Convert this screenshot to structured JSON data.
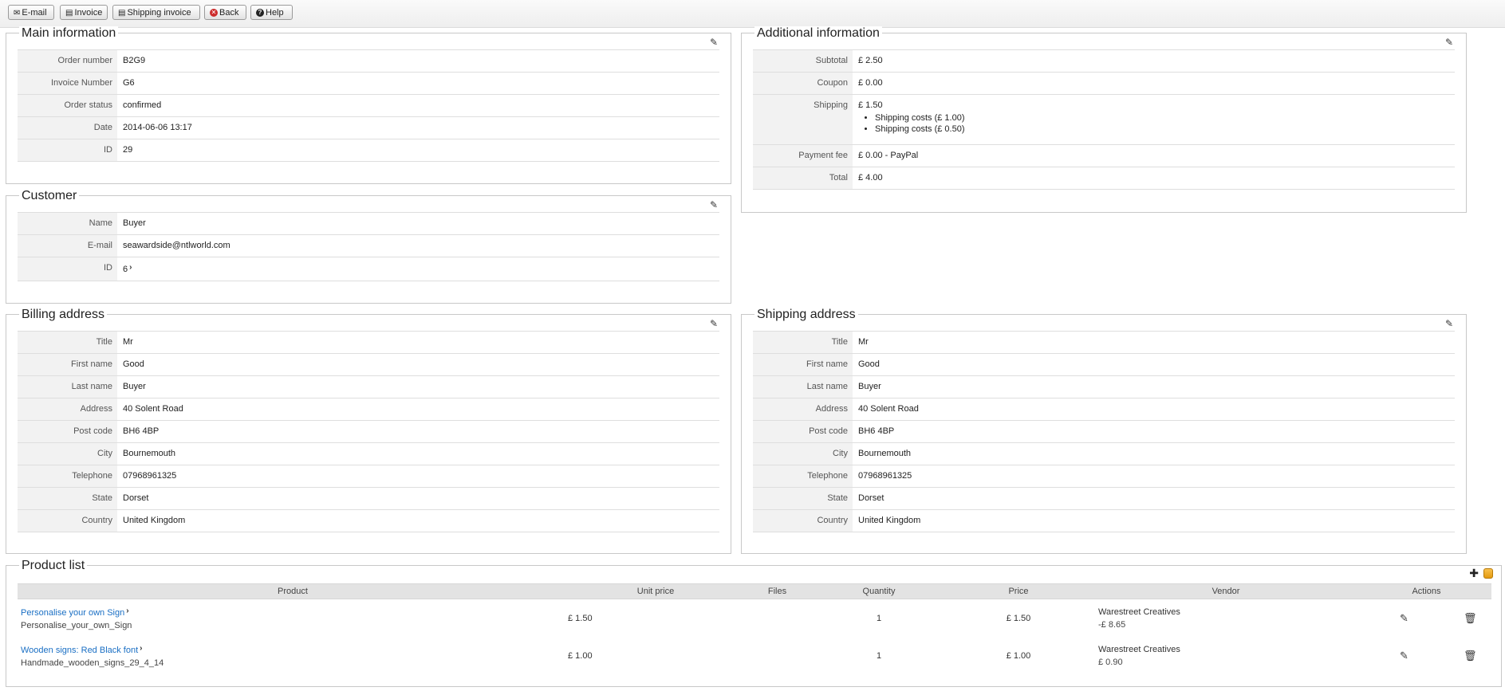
{
  "toolbar": {
    "email": "E-mail",
    "invoice": "Invoice",
    "shipping_invoice": "Shipping invoice",
    "back": "Back",
    "help": "Help"
  },
  "main_info": {
    "title": "Main information",
    "rows": [
      {
        "label": "Order number",
        "value": "B2G9"
      },
      {
        "label": "Invoice Number",
        "value": "G6"
      },
      {
        "label": "Order status",
        "value": "confirmed"
      },
      {
        "label": "Date",
        "value": "2014-06-06 13:17"
      },
      {
        "label": "ID",
        "value": "29"
      }
    ]
  },
  "additional_info": {
    "title": "Additional information",
    "subtotal_label": "Subtotal",
    "subtotal": "£ 2.50",
    "coupon_label": "Coupon",
    "coupon": "£ 0.00",
    "shipping_label": "Shipping",
    "shipping": "£ 1.50",
    "shipping_items": [
      "Shipping costs (£ 1.00)",
      "Shipping costs (£ 0.50)"
    ],
    "payment_fee_label": "Payment fee",
    "payment_fee": "£ 0.00 - PayPal",
    "total_label": "Total",
    "total": "£ 4.00"
  },
  "customer": {
    "title": "Customer",
    "name_label": "Name",
    "name": "Buyer",
    "email_label": "E-mail",
    "email": "seawardside@ntlworld.com",
    "id_label": "ID",
    "id": "6"
  },
  "billing": {
    "title": "Billing address",
    "rows": [
      {
        "label": "Title",
        "value": "Mr"
      },
      {
        "label": "First name",
        "value": "Good"
      },
      {
        "label": "Last name",
        "value": "Buyer"
      },
      {
        "label": "Address",
        "value": "40 Solent Road"
      },
      {
        "label": "Post code",
        "value": "BH6 4BP"
      },
      {
        "label": "City",
        "value": "Bournemouth"
      },
      {
        "label": "Telephone",
        "value": "07968961325"
      },
      {
        "label": "State",
        "value": "Dorset"
      },
      {
        "label": "Country",
        "value": "United Kingdom"
      }
    ]
  },
  "shipping_addr": {
    "title": "Shipping address",
    "rows": [
      {
        "label": "Title",
        "value": "Mr"
      },
      {
        "label": "First name",
        "value": "Good"
      },
      {
        "label": "Last name",
        "value": "Buyer"
      },
      {
        "label": "Address",
        "value": "40 Solent Road"
      },
      {
        "label": "Post code",
        "value": "BH6 4BP"
      },
      {
        "label": "City",
        "value": "Bournemouth"
      },
      {
        "label": "Telephone",
        "value": "07968961325"
      },
      {
        "label": "State",
        "value": "Dorset"
      },
      {
        "label": "Country",
        "value": "United Kingdom"
      }
    ]
  },
  "products": {
    "title": "Product list",
    "headers": {
      "product": "Product",
      "unit_price": "Unit price",
      "files": "Files",
      "quantity": "Quantity",
      "price": "Price",
      "vendor": "Vendor",
      "actions": "Actions"
    },
    "items": [
      {
        "name": "Personalise your own Sign",
        "sku": "Personalise_your_own_Sign",
        "unit_price": "£ 1.50",
        "files": "",
        "quantity": "1",
        "price": "£ 1.50",
        "vendor": "Warestreet Creatives",
        "vendor_amount": "-£ 8.65"
      },
      {
        "name": "Wooden signs: Red Black font",
        "sku": "Handmade_wooden_signs_29_4_14",
        "unit_price": "£ 1.00",
        "files": "",
        "quantity": "1",
        "price": "£ 1.00",
        "vendor": "Warestreet Creatives",
        "vendor_amount": "£ 0.90"
      }
    ]
  },
  "icons": {
    "email": "envelope-icon",
    "invoice": "document-icon",
    "shipping_invoice": "truck-document-icon",
    "back": "cancel-circle-icon",
    "help": "question-circle-icon",
    "edit": "pencil-icon",
    "delete": "trash-icon",
    "add": "plus-icon",
    "database": "database-icon",
    "link": "chevron-right-icon"
  },
  "colors": {
    "link": "#1a6fc4",
    "back_icon": "#cc2b2b",
    "database_icon": "#f0a91e"
  }
}
